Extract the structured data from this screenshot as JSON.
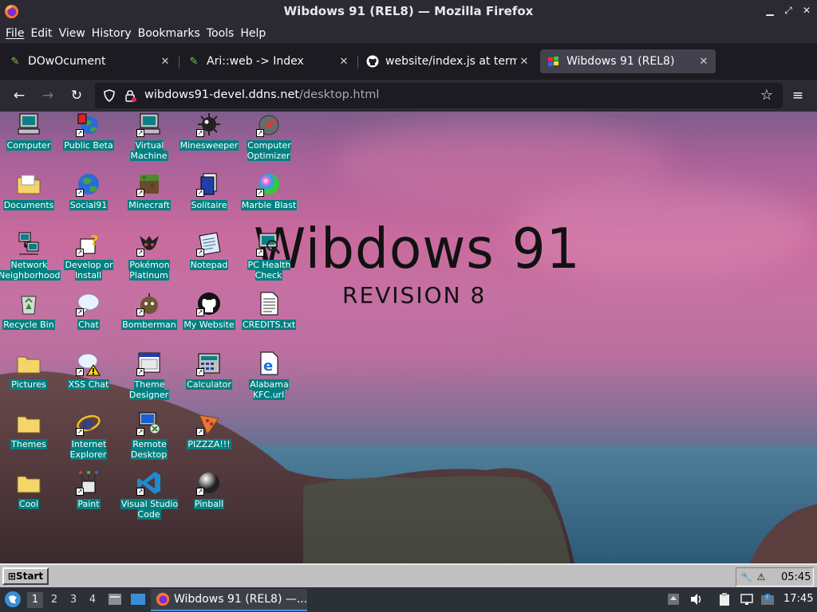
{
  "window": {
    "title": "Wibdows 91 (REL8) — Mozilla Firefox"
  },
  "menubar": {
    "items": [
      "File",
      "Edit",
      "View",
      "History",
      "Bookmarks",
      "Tools",
      "Help"
    ]
  },
  "tabs": [
    {
      "label": "DOwOcument",
      "icon": "wiki-icon",
      "active": false
    },
    {
      "label": "Ari::web -> Index",
      "icon": "wiki-icon",
      "active": false
    },
    {
      "label": "website/index.js at termi",
      "icon": "github-icon",
      "active": false
    },
    {
      "label": "Wibdows 91 (REL8)",
      "icon": "wibdows-icon",
      "active": true
    }
  ],
  "navbar": {
    "url_host": "wibdows91-devel.ddns.net",
    "url_path": "/desktop.html"
  },
  "desktop": {
    "watermark_title": "Wibdows 91",
    "watermark_subtitle": "REVISION 8",
    "icons": [
      {
        "label": "Computer",
        "icon": "computer-icon",
        "shortcut": false
      },
      {
        "label": "Public Beta",
        "icon": "public-beta-icon",
        "shortcut": true
      },
      {
        "label": "Virtual Machine",
        "icon": "virtual-machine-icon",
        "shortcut": true
      },
      {
        "label": "Minesweeper",
        "icon": "minesweeper-icon",
        "shortcut": true
      },
      {
        "label": "Computer Optimizer",
        "icon": "computer-optimizer-icon",
        "shortcut": true
      },
      {
        "label": "Documents",
        "icon": "documents-folder-icon",
        "shortcut": false
      },
      {
        "label": "Social91",
        "icon": "social91-icon",
        "shortcut": true
      },
      {
        "label": "Minecraft",
        "icon": "minecraft-icon",
        "shortcut": true
      },
      {
        "label": "Solitaire",
        "icon": "solitaire-icon",
        "shortcut": true
      },
      {
        "label": "Marble Blast",
        "icon": "marble-blast-icon",
        "shortcut": true
      },
      {
        "label": "Network Neighborhood",
        "icon": "network-icon",
        "shortcut": false
      },
      {
        "label": "Develop or Install",
        "icon": "develop-icon",
        "shortcut": true
      },
      {
        "label": "Pokémon Platinum",
        "icon": "pokemon-icon",
        "shortcut": true
      },
      {
        "label": "Notepad",
        "icon": "notepad-icon",
        "shortcut": true
      },
      {
        "label": "PC Health Check",
        "icon": "pc-health-icon",
        "shortcut": true
      },
      {
        "label": "Recycle Bin",
        "icon": "recycle-bin-icon",
        "shortcut": false
      },
      {
        "label": "Chat",
        "icon": "chat-icon",
        "shortcut": true
      },
      {
        "label": "Bomberman",
        "icon": "bomberman-icon",
        "shortcut": true
      },
      {
        "label": "My Website",
        "icon": "github-icon",
        "shortcut": true
      },
      {
        "label": "CREDITS.txt",
        "icon": "text-file-icon",
        "shortcut": false
      },
      {
        "label": "Pictures",
        "icon": "pictures-folder-icon",
        "shortcut": false
      },
      {
        "label": "XSS Chat",
        "icon": "xss-chat-icon",
        "shortcut": true
      },
      {
        "label": "Theme Designer",
        "icon": "theme-designer-icon",
        "shortcut": true
      },
      {
        "label": "Calculator",
        "icon": "calculator-icon",
        "shortcut": true
      },
      {
        "label": "Alabama KFC.url",
        "icon": "ie-link-icon",
        "shortcut": false
      },
      {
        "label": "Themes",
        "icon": "themes-folder-icon",
        "shortcut": false
      },
      {
        "label": "Internet Explorer",
        "icon": "internet-explorer-icon",
        "shortcut": true
      },
      {
        "label": "Remote Desktop",
        "icon": "remote-desktop-icon",
        "shortcut": true
      },
      {
        "label": "PIZZZA!!!",
        "icon": "pizza-icon",
        "shortcut": true
      },
      {
        "label": "Cool",
        "icon": "cool-folder-icon",
        "shortcut": false
      },
      {
        "label": "Paint",
        "icon": "paint-icon",
        "shortcut": true
      },
      {
        "label": "Visual Studio Code",
        "icon": "vscode-icon",
        "shortcut": true
      },
      {
        "label": "Pinball",
        "icon": "pinball-icon",
        "shortcut": true
      }
    ]
  },
  "w91_taskbar": {
    "start_label": "Start",
    "clock": "05:45"
  },
  "os_panel": {
    "workspaces": [
      "1",
      "2",
      "3",
      "4"
    ],
    "active_workspace": "1",
    "task_label": "Wibdows 91 (REL8) —...",
    "clock": "17:45"
  }
}
